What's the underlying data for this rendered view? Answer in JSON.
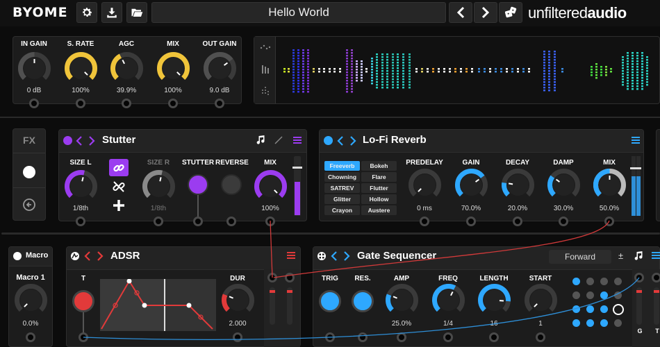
{
  "topbar": {
    "logo": "BYOME",
    "preset_name": "Hello World",
    "brand_left": "unfiltered",
    "brand_right": "audio"
  },
  "io": {
    "knobs": [
      {
        "label": "IN GAIN",
        "value": "0 dB",
        "level": 0.5,
        "color": "#505050"
      },
      {
        "label": "S. RATE",
        "value": "100%",
        "level": 1.0,
        "color": "#f0c43a"
      },
      {
        "label": "AGC",
        "value": "39.9%",
        "level": 0.4,
        "color": "#f0c43a"
      },
      {
        "label": "MIX",
        "value": "100%",
        "level": 1.0,
        "color": "#f0c43a"
      },
      {
        "label": "OUT GAIN",
        "value": "9.0 dB",
        "level": 0.7,
        "color": "#505050"
      }
    ]
  },
  "fx_sidebar": {
    "label": "FX"
  },
  "stutter": {
    "title": "Stutter",
    "accent": "#9b3cf0",
    "knobs": [
      {
        "label": "SIZE L",
        "value": "1/8th",
        "level": 0.55
      },
      {
        "label": "SIZE R",
        "value": "1/8th",
        "level": 0.55
      },
      {
        "label": "MIX",
        "value": "100%",
        "level": 1.0
      }
    ],
    "stutter_label": "STUTTER",
    "reverse_label": "REVERSE"
  },
  "lofi": {
    "title": "Lo-Fi Reverb",
    "accent": "#2ea8ff",
    "reverb_types": [
      [
        "Freeverb",
        "Bokeh"
      ],
      [
        "Chowning",
        "Flare"
      ],
      [
        "SATREV",
        "Flutter"
      ],
      [
        "Glitter",
        "Hollow"
      ],
      [
        "Crayon",
        "Austere"
      ]
    ],
    "knobs": [
      {
        "label": "PREDELAY",
        "value": "0 ms",
        "level": 0.0
      },
      {
        "label": "GAIN",
        "value": "70.0%",
        "level": 0.7
      },
      {
        "label": "DECAY",
        "value": "20.0%",
        "level": 0.2
      },
      {
        "label": "DAMP",
        "value": "30.0%",
        "level": 0.3
      },
      {
        "label": "MIX",
        "value": "50.0%",
        "level": 0.5
      }
    ]
  },
  "macro": {
    "title": "Macro",
    "knob_label": "Macro 1",
    "value": "0.0%",
    "level": 0.0
  },
  "adsr": {
    "title": "ADSR",
    "accent": "#e23a3a",
    "trigger_label": "T",
    "dur_label": "DUR",
    "dur_value": "2.000",
    "dur_level": 0.25
  },
  "gate": {
    "title": "Gate Sequencer",
    "accent": "#2ea8ff",
    "mode": "Forward",
    "trig_label": "TRIG",
    "res_label": "RES.",
    "knobs": [
      {
        "label": "AMP",
        "value": "25.0%",
        "level": 0.25
      },
      {
        "label": "FREQ",
        "value": "1/4",
        "level": 0.6
      },
      {
        "label": "LENGTH",
        "value": "16",
        "level": 0.85
      },
      {
        "label": "START",
        "value": "1",
        "level": 0.0
      }
    ],
    "output_labels": [
      "G",
      "T"
    ],
    "steps": [
      1,
      0,
      0,
      0,
      0,
      0,
      1,
      0,
      1,
      1,
      1,
      2,
      1,
      1,
      1,
      0
    ]
  }
}
